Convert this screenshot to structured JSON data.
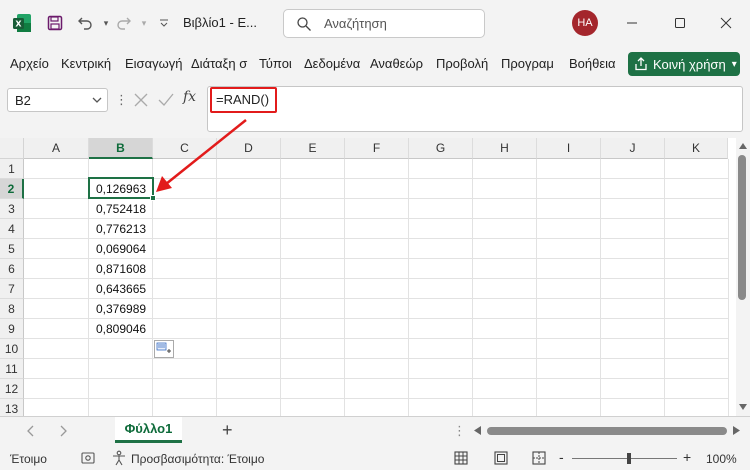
{
  "titlebar": {
    "doc_title": "Βιβλίο1  -  E...",
    "search_placeholder": "Αναζήτηση",
    "avatar_initials": "HA"
  },
  "ribbon": {
    "tabs": [
      "Αρχείο",
      "Κεντρική",
      "Εισαγωγή",
      "Διάταξη σ",
      "Τύποι",
      "Δεδομένα",
      "Αναθεώρ",
      "Προβολή",
      "Προγραμ",
      "Βοήθεια"
    ],
    "share_label": "Κοινή χρήση"
  },
  "formula_bar": {
    "name_box": "B2",
    "fx_label": "fx",
    "formula": "=RAND()"
  },
  "grid": {
    "columns": [
      "A",
      "B",
      "C",
      "D",
      "E",
      "F",
      "G",
      "H",
      "I",
      "J",
      "K"
    ],
    "rows": [
      "1",
      "2",
      "3",
      "4",
      "5",
      "6",
      "7",
      "8",
      "9",
      "10",
      "11",
      "12",
      "13"
    ],
    "selected_column": "B",
    "selected_row": "2",
    "b_values": [
      "0,126963",
      "0,752418",
      "0,776213",
      "0,069064",
      "0,871608",
      "0,643665",
      "0,376989",
      "0,809046"
    ]
  },
  "sheets": {
    "active": "Φύλλο1",
    "add_label": "+"
  },
  "status": {
    "ready": "Έτοιμο",
    "accessibility": "Προσβασιμότητα: Έτοιμο",
    "zoom": "100%",
    "zoom_minus": "-",
    "zoom_plus": "+"
  },
  "colors": {
    "accent": "#1e7145",
    "annotation": "#e21b1b",
    "avatar": "#a4262c"
  }
}
